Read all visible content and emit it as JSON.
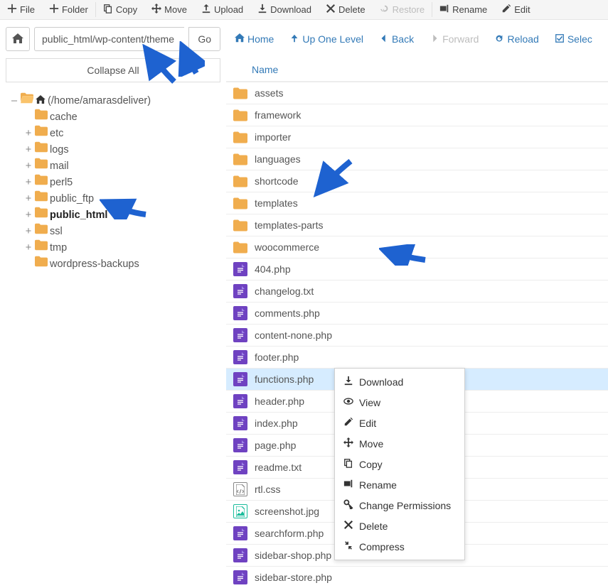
{
  "toolbar": [
    {
      "name": "file-button",
      "icon": "plus",
      "label": "File",
      "disabled": false
    },
    {
      "name": "folder-button",
      "icon": "plus",
      "label": "Folder",
      "disabled": false
    },
    {
      "sep": true
    },
    {
      "name": "copy-button",
      "icon": "copy",
      "label": "Copy",
      "disabled": false
    },
    {
      "name": "move-button",
      "icon": "move",
      "label": "Move",
      "disabled": false
    },
    {
      "name": "upload-button",
      "icon": "upload",
      "label": "Upload",
      "disabled": false
    },
    {
      "name": "download-button",
      "icon": "download",
      "label": "Download",
      "disabled": false
    },
    {
      "name": "delete-button",
      "icon": "delete",
      "label": "Delete",
      "disabled": false
    },
    {
      "name": "restore-button",
      "icon": "restore",
      "label": "Restore",
      "disabled": true
    },
    {
      "sep": true
    },
    {
      "name": "rename-button",
      "icon": "rename",
      "label": "Rename",
      "disabled": false
    },
    {
      "name": "edit-button",
      "icon": "edit",
      "label": "Edit",
      "disabled": false
    }
  ],
  "path": {
    "value": "public_html/wp-content/theme",
    "go_label": "Go"
  },
  "navbar": [
    {
      "name": "nav-home",
      "icon": "home",
      "label": "Home",
      "disabled": false
    },
    {
      "name": "nav-up",
      "icon": "up",
      "label": "Up One Level",
      "disabled": false
    },
    {
      "name": "nav-back",
      "icon": "back",
      "label": "Back",
      "disabled": false
    },
    {
      "name": "nav-forward",
      "icon": "forward",
      "label": "Forward",
      "disabled": true
    },
    {
      "name": "nav-reload",
      "icon": "reload",
      "label": "Reload",
      "disabled": false
    },
    {
      "name": "nav-select",
      "icon": "select",
      "label": "Selec",
      "disabled": false
    }
  ],
  "collapse_label": "Collapse All",
  "tree": {
    "root_label": "(/home/amarasdeliver)",
    "children": [
      {
        "label": "cache",
        "toggle": ""
      },
      {
        "label": "etc",
        "toggle": "+"
      },
      {
        "label": "logs",
        "toggle": "+"
      },
      {
        "label": "mail",
        "toggle": "+"
      },
      {
        "label": "perl5",
        "toggle": "+"
      },
      {
        "label": "public_ftp",
        "toggle": "+"
      },
      {
        "label": "public_html",
        "toggle": "+",
        "bold": true
      },
      {
        "label": "ssl",
        "toggle": "+"
      },
      {
        "label": "tmp",
        "toggle": "+"
      },
      {
        "label": "wordpress-backups",
        "toggle": ""
      }
    ]
  },
  "col_header": "Name",
  "files": [
    {
      "type": "folder",
      "name": "assets"
    },
    {
      "type": "folder",
      "name": "framework"
    },
    {
      "type": "folder",
      "name": "importer"
    },
    {
      "type": "folder",
      "name": "languages"
    },
    {
      "type": "folder",
      "name": "shortcode"
    },
    {
      "type": "folder",
      "name": "templates"
    },
    {
      "type": "folder",
      "name": "templates-parts"
    },
    {
      "type": "folder",
      "name": "woocommerce"
    },
    {
      "type": "doc",
      "name": "404.php"
    },
    {
      "type": "doc",
      "name": "changelog.txt"
    },
    {
      "type": "doc",
      "name": "comments.php"
    },
    {
      "type": "doc",
      "name": "content-none.php"
    },
    {
      "type": "doc",
      "name": "footer.php"
    },
    {
      "type": "doc",
      "name": "functions.php",
      "selected": true
    },
    {
      "type": "doc",
      "name": "header.php"
    },
    {
      "type": "doc",
      "name": "index.php"
    },
    {
      "type": "doc",
      "name": "page.php"
    },
    {
      "type": "doc",
      "name": "readme.txt"
    },
    {
      "type": "css",
      "name": "rtl.css"
    },
    {
      "type": "img",
      "name": "screenshot.jpg"
    },
    {
      "type": "doc",
      "name": "searchform.php"
    },
    {
      "type": "doc",
      "name": "sidebar-shop.php"
    },
    {
      "type": "doc",
      "name": "sidebar-store.php"
    }
  ],
  "context_menu": [
    {
      "name": "ctx-download",
      "icon": "download",
      "label": "Download"
    },
    {
      "name": "ctx-view",
      "icon": "view",
      "label": "View"
    },
    {
      "name": "ctx-edit",
      "icon": "edit",
      "label": "Edit"
    },
    {
      "name": "ctx-move",
      "icon": "move",
      "label": "Move"
    },
    {
      "name": "ctx-copy",
      "icon": "copy",
      "label": "Copy"
    },
    {
      "name": "ctx-rename",
      "icon": "rename",
      "label": "Rename"
    },
    {
      "name": "ctx-perms",
      "icon": "key",
      "label": "Change Permissions"
    },
    {
      "name": "ctx-delete",
      "icon": "delete",
      "label": "Delete"
    },
    {
      "name": "ctx-compress",
      "icon": "compress",
      "label": "Compress"
    }
  ]
}
